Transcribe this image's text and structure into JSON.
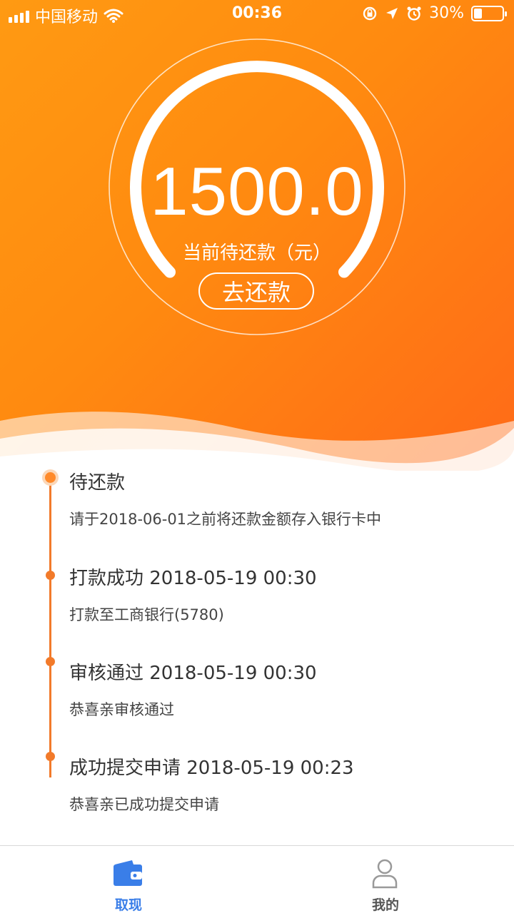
{
  "status_bar": {
    "carrier": "中国移动",
    "time": "00:36",
    "battery": "30%",
    "battery_level": 0.3
  },
  "summary": {
    "amount": "1500.0",
    "label": "当前待还款（元）",
    "repay_button": "去还款"
  },
  "timeline": [
    {
      "title": "待还款",
      "desc": "请于2018-06-01之前将还款金额存入银行卡中",
      "current": true
    },
    {
      "title": "打款成功 2018-05-19 00:30",
      "desc": "打款至工商银行(5780)",
      "current": false
    },
    {
      "title": "审核通过 2018-05-19 00:30",
      "desc": "恭喜亲审核通过",
      "current": false
    },
    {
      "title": "成功提交申请 2018-05-19 00:23",
      "desc": "恭喜亲已成功提交申请",
      "current": false
    }
  ],
  "tabs": [
    {
      "label": "取现",
      "icon": "wallet-icon",
      "active": true
    },
    {
      "label": "我的",
      "icon": "user-icon",
      "active": false
    }
  ],
  "colors": {
    "accent": "#f27a2a",
    "tab_active": "#3a7ee8",
    "hero_start": "#ff9a12",
    "hero_end": "#ff6a18"
  }
}
